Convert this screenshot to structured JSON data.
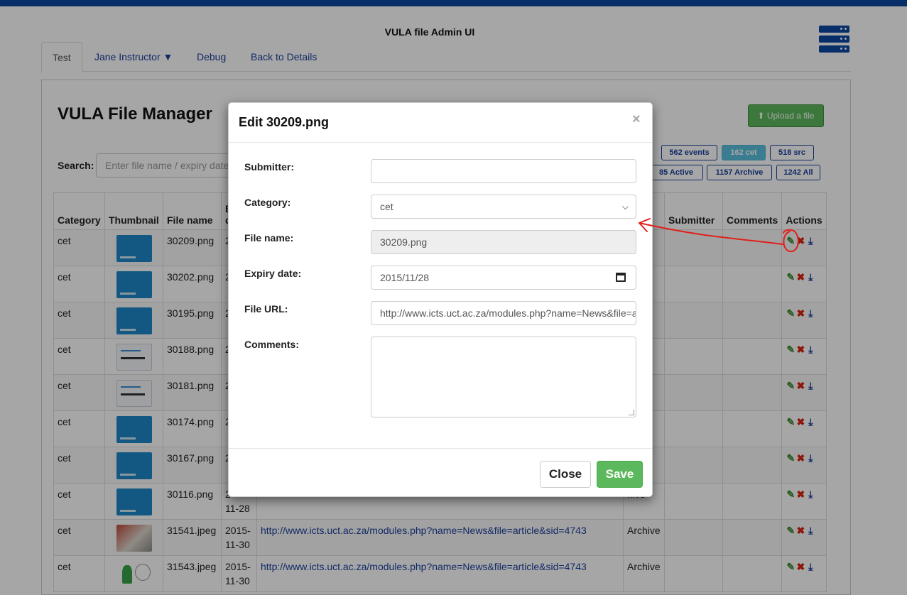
{
  "app": {
    "title": "VULA file Admin UI",
    "server_icon": "server-stack-icon"
  },
  "tabs": [
    {
      "label": "Test"
    },
    {
      "label": "Jane Instructor ▼"
    },
    {
      "label": "Debug"
    },
    {
      "label": "Back to Details"
    }
  ],
  "page": {
    "title": "VULA File Manager",
    "upload_label": "Upload a file",
    "upload_icon": "upload-icon",
    "search_label": "Search:",
    "search_placeholder": "Enter file name / expiry date",
    "filter_prefix": "y:",
    "filters": [
      {
        "label": "562 events"
      },
      {
        "label": "162 cet",
        "selected": true
      },
      {
        "label": "518 src"
      },
      {
        "label": "85 Active"
      },
      {
        "label": "1157 Archive"
      },
      {
        "label": "1242 All"
      }
    ]
  },
  "table": {
    "headers": {
      "category": "Category",
      "thumbnail": "Thumbnail",
      "file_name": "File name",
      "expiry": "E",
      "expiry2": "d",
      "url": "",
      "status": "us",
      "submitter": "Submitter",
      "comments": "Comments",
      "actions": "Actions"
    },
    "action_icons": [
      "pencil-icon",
      "delete-x-icon",
      "download-icon"
    ],
    "rows": [
      {
        "category": "cet",
        "thumb": "blue",
        "file": "30209.png",
        "date1": "2",
        "date2": "",
        "url": "",
        "status": "ive"
      },
      {
        "category": "cet",
        "thumb": "blue",
        "file": "30202.png",
        "date1": "2",
        "date2": "",
        "url": "",
        "status": "ve"
      },
      {
        "category": "cet",
        "thumb": "blue",
        "file": "30195.png",
        "date1": "2",
        "date2": "",
        "url": "",
        "status": "ive"
      },
      {
        "category": "cet",
        "thumb": "white",
        "file": "30188.png",
        "date1": "2",
        "date2": "",
        "url": "",
        "status": "ive"
      },
      {
        "category": "cet",
        "thumb": "white",
        "file": "30181.png",
        "date1": "2",
        "date2": "",
        "url": "",
        "status": "ive"
      },
      {
        "category": "cet",
        "thumb": "blue",
        "file": "30174.png",
        "date1": "2",
        "date2": "",
        "url": "",
        "status": "ve"
      },
      {
        "category": "cet",
        "thumb": "blue",
        "file": "30167.png",
        "date1": "2",
        "date2": "",
        "url": "",
        "status": "ive"
      },
      {
        "category": "cet",
        "thumb": "blue",
        "file": "30116.png",
        "date1": "2",
        "date2": "11-28",
        "url": "",
        "status": "hive"
      },
      {
        "category": "cet",
        "thumb": "photo",
        "file": "31541.jpeg",
        "date1": "2015-",
        "date2": "11-30",
        "url": "http://www.icts.uct.ac.za/modules.php?name=News&file=article&sid=4743",
        "status": "Archive"
      },
      {
        "category": "cet",
        "thumb": "cartoon",
        "file": "31543.jpeg",
        "date1": "2015-",
        "date2": "11-30",
        "url": "http://www.icts.uct.ac.za/modules.php?name=News&file=article&sid=4743",
        "status": "Archive"
      }
    ]
  },
  "modal": {
    "title": "Edit 30209.png",
    "close_x": "×",
    "fields": {
      "submitter_label": "Submitter:",
      "submitter_value": "",
      "category_label": "Category:",
      "category_value": "cet",
      "file_name_label": "File name:",
      "file_name_value": "30209.png",
      "expiry_label": "Expiry date:",
      "expiry_value": "2015/11/28",
      "url_label": "File URL:",
      "url_value": "http://www.icts.uct.ac.za/modules.php?name=News&file=article&sid=4743",
      "comments_label": "Comments:",
      "comments_value": ""
    },
    "close_label": "Close",
    "save_label": "Save"
  },
  "colors": {
    "brand": "#0d47a1",
    "success": "#5cb85c",
    "annotation": "#e0201b"
  }
}
